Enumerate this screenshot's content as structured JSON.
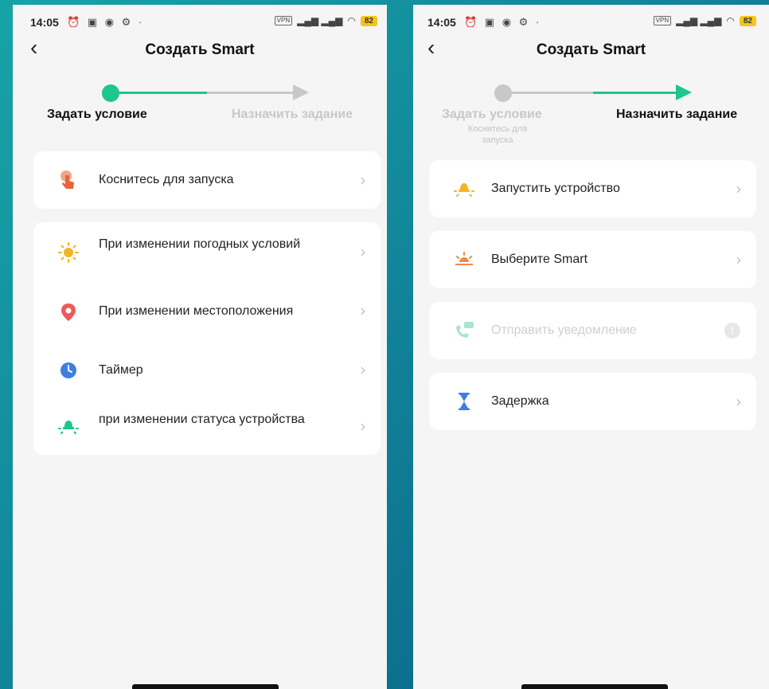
{
  "status": {
    "time": "14:05",
    "vpn": "VPN",
    "battery": "82"
  },
  "header": {
    "title": "Создать Smart"
  },
  "steps": {
    "step1": "Задать условие",
    "step2": "Назначить задание",
    "step1_sub": "Коснитесь для запуска"
  },
  "left": {
    "card1": [
      {
        "label": "Коснитесь для запуска",
        "icon": "tap-hand-icon"
      }
    ],
    "card2": [
      {
        "label": "При изменении погодных условий",
        "icon": "sun-icon"
      },
      {
        "label": "При изменении местоположения",
        "icon": "location-pin-icon"
      },
      {
        "label": "Таймер",
        "icon": "clock-icon"
      },
      {
        "label": "при изменении статуса устройства",
        "icon": "device-bulb-icon"
      }
    ]
  },
  "right": {
    "items": [
      {
        "label": "Запустить устройство",
        "icon": "device-bulb-icon"
      },
      {
        "label": "Выберите Smart",
        "icon": "sunrise-icon"
      },
      {
        "label": "Отправить уведомление",
        "icon": "notification-phone-icon",
        "disabled": true
      },
      {
        "label": "Задержка",
        "icon": "hourglass-icon"
      }
    ]
  },
  "colors": {
    "accent": "#1ec58f",
    "inactive": "#c8c8c8",
    "card": "#ffffff",
    "screen": "#f5f5f5"
  }
}
